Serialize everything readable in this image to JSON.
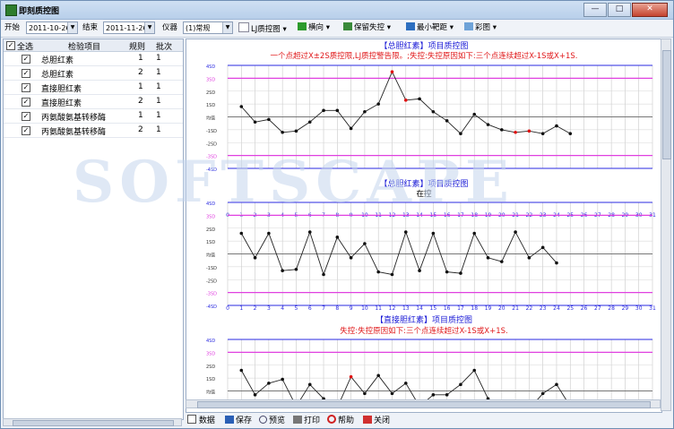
{
  "window": {
    "title": "即刻质控图"
  },
  "window_buttons": {
    "minimize": "—",
    "maximize": "□",
    "close": "✕"
  },
  "toolbar": {
    "start_label": "开始",
    "start_date": "2011-10-26",
    "end_label": "结束",
    "end_date": "2011-11-26",
    "instrument_label": "仪器",
    "instrument_value": "(1)常规",
    "lj_chart": "LJ质控图",
    "direction": "横向",
    "keep_oos": "保留失控",
    "min_range": "最小靶距",
    "color_chart": "彩图"
  },
  "table": {
    "headers": {
      "select_all": "全选",
      "item": "检验项目",
      "rule": "规则",
      "batch": "批次"
    },
    "rows": [
      {
        "checked": true,
        "item": "总胆红素",
        "rule": "1",
        "batch": "1"
      },
      {
        "checked": true,
        "item": "总胆红素",
        "rule": "2",
        "batch": "1"
      },
      {
        "checked": true,
        "item": "直接胆红素",
        "rule": "1",
        "batch": "1"
      },
      {
        "checked": true,
        "item": "直接胆红素",
        "rule": "2",
        "batch": "1"
      },
      {
        "checked": true,
        "item": "丙氨酸氨基转移酶",
        "rule": "1",
        "batch": "1"
      },
      {
        "checked": true,
        "item": "丙氨酸氨基转移酶",
        "rule": "2",
        "batch": "1"
      }
    ]
  },
  "bottom": {
    "data": "数据",
    "save": "保存",
    "preview": "预览",
    "print": "打印",
    "help": "帮助",
    "close": "关闭"
  },
  "watermark": "SOFTSCAPE",
  "colors": {
    "title_blue": "#1a1ad6",
    "warn_red": "#e0181a",
    "limit_magenta": "#e040e0",
    "outer_blue": "#2a2ae0",
    "out_point": "#e01010"
  },
  "chart_data": [
    {
      "type": "line",
      "title": "【总胆红素】项目质控图",
      "subtitle": "一个点超过X±2S质控限,LJ质控警告限。;失控:失控原因如下:三个点连续超过X-1S或X+1S.",
      "y_tick_labels": [
        "4SD",
        "3SD",
        "2SD",
        "1SD",
        "均值",
        "-1SD",
        "-2SD",
        "-3SD",
        "-4SD"
      ],
      "x_tick_labels": [
        "0",
        "1",
        "2",
        "3",
        "4",
        "5",
        "6",
        "7",
        "8",
        "9",
        "10",
        "11",
        "12",
        "13",
        "14",
        "15",
        "16",
        "17",
        "18",
        "19",
        "20",
        "21",
        "22",
        "23",
        "24",
        "25",
        "26",
        "27",
        "28",
        "29",
        "30",
        "31"
      ],
      "ylim": [
        -4,
        4
      ],
      "x": [
        1,
        2,
        3,
        4,
        5,
        6,
        7,
        8,
        9,
        10,
        11,
        12,
        13,
        14,
        15,
        16,
        17,
        18,
        19,
        20,
        21,
        22,
        23,
        24,
        25
      ],
      "values": [
        0.8,
        -0.4,
        -0.2,
        -1.2,
        -1.1,
        -0.4,
        0.5,
        0.5,
        -0.9,
        0.4,
        1.0,
        3.5,
        1.3,
        1.4,
        0.4,
        -0.3,
        -1.3,
        0.2,
        -0.6,
        -1.0,
        -1.2,
        -1.1,
        -1.3,
        -0.7,
        -1.3
      ],
      "out_of_control": [
        12,
        13,
        21,
        22
      ]
    },
    {
      "type": "line",
      "title": "【总胆红素】项目质控图",
      "subtitle": "在控",
      "y_tick_labels": [
        "4SD",
        "3SD",
        "2SD",
        "1SD",
        "均值",
        "-1SD",
        "-2SD",
        "-3SD",
        "-4SD"
      ],
      "x_tick_labels": [
        "0",
        "1",
        "2",
        "3",
        "4",
        "5",
        "6",
        "7",
        "8",
        "9",
        "10",
        "11",
        "12",
        "13",
        "14",
        "15",
        "16",
        "17",
        "18",
        "19",
        "20",
        "21",
        "22",
        "23",
        "24",
        "25",
        "26",
        "27",
        "28",
        "29",
        "30",
        "31"
      ],
      "ylim": [
        -4,
        4
      ],
      "x": [
        1,
        2,
        3,
        4,
        5,
        6,
        7,
        8,
        9,
        10,
        11,
        12,
        13,
        14,
        15,
        16,
        17,
        18,
        19,
        20,
        21,
        22,
        23,
        24
      ],
      "values": [
        1.6,
        -0.3,
        1.6,
        -1.3,
        -1.2,
        1.7,
        -1.6,
        1.3,
        -0.3,
        0.8,
        -1.4,
        -1.6,
        1.7,
        -1.3,
        1.6,
        -1.4,
        -1.5,
        1.6,
        -0.3,
        -0.6,
        1.7,
        -0.3,
        0.5,
        -0.7,
        1.6
      ],
      "out_of_control": []
    },
    {
      "type": "line",
      "title": "【直接胆红素】项目质控图",
      "subtitle": "失控:失控原因如下:三个点连续超过X-1S或X+1S.",
      "y_tick_labels": [
        "4SD",
        "3SD",
        "2SD",
        "1SD",
        "均值"
      ],
      "x_tick_labels": [],
      "ylim": [
        -4,
        4
      ],
      "x": [
        1,
        2,
        3,
        4,
        5,
        6,
        7,
        8,
        9,
        10,
        11,
        12,
        13,
        14,
        15,
        16,
        17,
        18,
        19,
        20,
        21,
        22,
        23,
        24,
        25
      ],
      "values": [
        1.6,
        -0.3,
        0.6,
        0.9,
        -1.2,
        0.5,
        -0.6,
        -1.3,
        1.1,
        -0.2,
        1.2,
        -0.2,
        0.6,
        -1.2,
        -0.3,
        -0.3,
        0.5,
        1.6,
        -0.6,
        -1.4,
        -1.3,
        -1.4,
        -0.2,
        0.5,
        -1.2
      ],
      "out_of_control": [
        9
      ]
    }
  ]
}
